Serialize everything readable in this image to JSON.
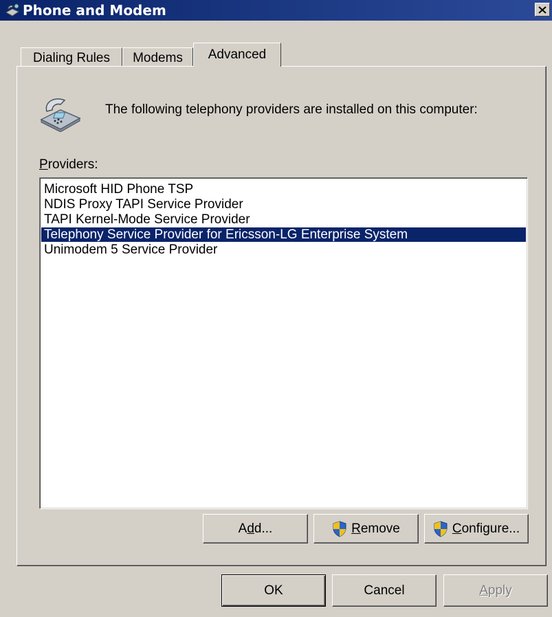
{
  "window": {
    "title": "Phone and Modem",
    "title_icon": "phone-modem-icon",
    "close_icon": "close-icon"
  },
  "tabs": [
    {
      "label": "Dialing Rules",
      "active": false
    },
    {
      "label": "Modems",
      "active": false
    },
    {
      "label": "Advanced",
      "active": true
    }
  ],
  "advanced": {
    "intro_icon": "telephone-icon",
    "intro_text": "The following telephony providers are installed on this computer:",
    "providers_label_mnemonic": "P",
    "providers_label_rest": "roviders:",
    "providers": [
      "Microsoft HID Phone TSP",
      "NDIS Proxy TAPI Service Provider",
      "TAPI Kernel-Mode Service Provider",
      "Telephony Service Provider for Ericsson-LG Enterprise System",
      "Unimodem 5 Service Provider"
    ],
    "selected_index": 3,
    "buttons": {
      "add_pre": "A",
      "add_mnemonic": "d",
      "add_post": "d...",
      "remove_mnemonic": "R",
      "remove_post": "emove",
      "remove_icon": "uac-shield-icon",
      "configure_mnemonic": "C",
      "configure_post": "onfigure...",
      "configure_icon": "uac-shield-icon"
    }
  },
  "footer": {
    "ok": "OK",
    "cancel": "Cancel",
    "apply_mnemonic": "A",
    "apply_post": "pply",
    "apply_enabled": false
  },
  "colors": {
    "title_bar": "#0a246a",
    "selection": "#0a246a",
    "face": "#d4d0c8"
  }
}
